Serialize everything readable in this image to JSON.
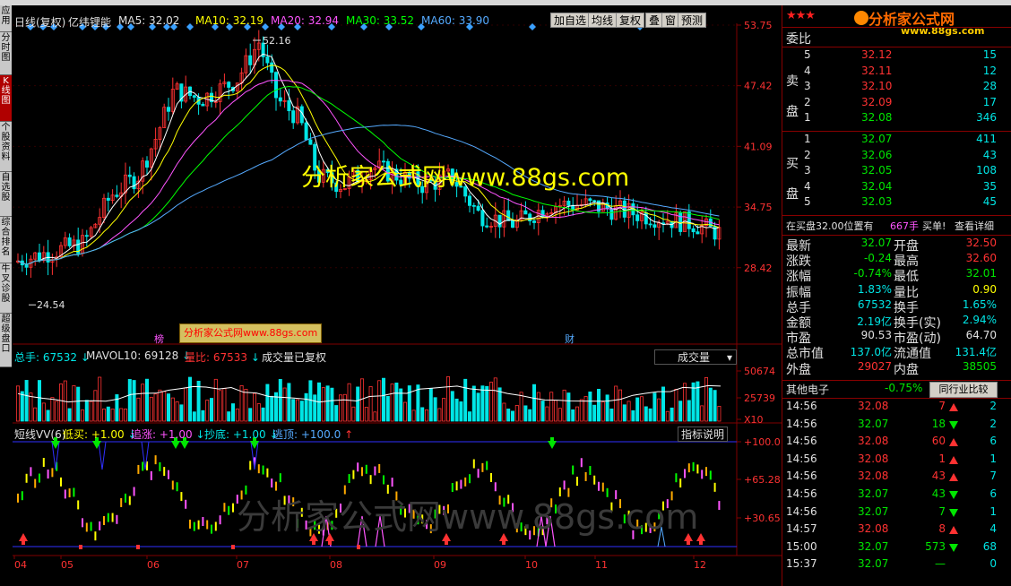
{
  "left_tabs": [
    "应用",
    "分时图",
    "K线图",
    "个股资料",
    "自选股",
    "综合排名",
    "牛叉诊股",
    "超级盘口"
  ],
  "main_header": {
    "period": "日线(复权)",
    "stock_name": "亿纬锂能",
    "ma5": "MA5: 32.02",
    "ma10": "MA10: 32.19",
    "ma20": "MA20: 32.94",
    "ma30": "MA30: 33.52",
    "ma60": "MA60: 33.90"
  },
  "toolbar": {
    "add_watch": "加自选",
    "avg_line": "均线",
    "restore_rights": "复权",
    "overlay": "叠",
    "window": "窗",
    "forecast": "预测"
  },
  "price_axis": [
    "53.75",
    "47.42",
    "41.09",
    "34.75",
    "28.42"
  ],
  "annotations": {
    "high": "52.16",
    "low": "24.54",
    "bang": "榜",
    "cai": "财"
  },
  "watermark_center": "分析家公式网www.88gs.com",
  "watermark_box": "分析家公式网www.88gs.com",
  "watermark_bottom": "分析家公式网www.88gs.com",
  "volume_header": {
    "total": "总手: 67532",
    "mavol": "MAVOL10: 69128",
    "ratio": "量比: 67533",
    "note": "成交量已复权",
    "selector": "成交量"
  },
  "volume_axis": [
    "50674",
    "25739",
    "X10"
  ],
  "indicator_header": {
    "name": "短线VV(6)",
    "low_buy": "低买: +1.00",
    "chase": "追涨: +1.00",
    "bottom": "抄底: +1.00",
    "escape": "逃顶: +100.0",
    "help": "指标说明"
  },
  "indicator_axis": [
    "+100.0",
    "+65.28",
    "+30.65"
  ],
  "x_axis": [
    "04",
    "05",
    "06",
    "07",
    "08",
    "09",
    "10",
    "11",
    "12"
  ],
  "logo": {
    "stars": "★★★",
    "text": "分析家公式网",
    "url": "www.88gs.com"
  },
  "order_book": {
    "ratio_label": "委比",
    "sell_label": [
      "卖",
      "盘"
    ],
    "buy_label": [
      "买",
      "盘"
    ],
    "sell": [
      {
        "level": "5",
        "price": "32.12",
        "vol": "15"
      },
      {
        "level": "4",
        "price": "32.11",
        "vol": "12"
      },
      {
        "level": "3",
        "price": "32.10",
        "vol": "28"
      },
      {
        "level": "2",
        "price": "32.09",
        "vol": "17"
      },
      {
        "level": "1",
        "price": "32.08",
        "vol": "346"
      }
    ],
    "buy": [
      {
        "level": "1",
        "price": "32.07",
        "vol": "411"
      },
      {
        "level": "2",
        "price": "32.06",
        "vol": "43"
      },
      {
        "level": "3",
        "price": "32.05",
        "vol": "108"
      },
      {
        "level": "4",
        "price": "32.04",
        "vol": "35"
      },
      {
        "level": "5",
        "price": "32.03",
        "vol": "45"
      }
    ],
    "status": {
      "text": "在买盘32.00位置有",
      "amount": "667手",
      "action": "买单!",
      "detail": "查看详细"
    }
  },
  "quote": [
    {
      "l1": "最新",
      "v1": "32.07",
      "c1": "green",
      "l2": "开盘",
      "v2": "32.50",
      "c2": "red"
    },
    {
      "l1": "涨跌",
      "v1": "-0.24",
      "c1": "green",
      "l2": "最高",
      "v2": "32.60",
      "c2": "red"
    },
    {
      "l1": "涨幅",
      "v1": "-0.74%",
      "c1": "green",
      "l2": "最低",
      "v2": "32.01",
      "c2": "green"
    },
    {
      "l1": "振幅",
      "v1": "1.83%",
      "c1": "cyan",
      "l2": "量比",
      "v2": "0.90",
      "c2": "yellow"
    },
    {
      "l1": "总手",
      "v1": "67532",
      "c1": "cyan",
      "l2": "换手",
      "v2": "1.65%",
      "c2": "cyan"
    },
    {
      "l1": "金额",
      "v1": "2.19亿",
      "c1": "cyan",
      "l2": "换手(实)",
      "v2": "2.94%",
      "c2": "cyan"
    },
    {
      "l1": "市盈",
      "v1": "90.53",
      "c1": "white",
      "l2": "市盈(动)",
      "v2": "64.70",
      "c2": "white"
    },
    {
      "l1": "总市值",
      "v1": "137.0亿",
      "c1": "cyan",
      "l2": "流通值",
      "v2": "131.4亿",
      "c2": "cyan"
    },
    {
      "l1": "外盘",
      "v1": "29027",
      "c1": "red",
      "l2": "内盘",
      "v2": "38505",
      "c2": "green"
    }
  ],
  "sector": {
    "name": "其他电子",
    "change": "-0.75%",
    "button": "同行业比较"
  },
  "trades": [
    {
      "time": "14:56",
      "price": "32.08",
      "pc": "red",
      "vol": "7",
      "vc": "red",
      "dir": "up",
      "cnt": "2"
    },
    {
      "time": "14:56",
      "price": "32.07",
      "pc": "green",
      "vol": "18",
      "vc": "green",
      "dir": "down",
      "cnt": "2"
    },
    {
      "time": "14:56",
      "price": "32.08",
      "pc": "red",
      "vol": "60",
      "vc": "red",
      "dir": "up",
      "cnt": "6"
    },
    {
      "time": "14:56",
      "price": "32.08",
      "pc": "red",
      "vol": "1",
      "vc": "red",
      "dir": "up",
      "cnt": "1"
    },
    {
      "time": "14:56",
      "price": "32.08",
      "pc": "red",
      "vol": "43",
      "vc": "red",
      "dir": "up",
      "cnt": "7"
    },
    {
      "time": "14:56",
      "price": "32.07",
      "pc": "green",
      "vol": "43",
      "vc": "green",
      "dir": "down",
      "cnt": "6"
    },
    {
      "time": "14:56",
      "price": "32.07",
      "pc": "green",
      "vol": "7",
      "vc": "green",
      "dir": "down",
      "cnt": "1"
    },
    {
      "time": "14:57",
      "price": "32.08",
      "pc": "red",
      "vol": "8",
      "vc": "red",
      "dir": "up",
      "cnt": "4"
    },
    {
      "time": "15:00",
      "price": "32.07",
      "pc": "green",
      "vol": "573",
      "vc": "green",
      "dir": "down",
      "cnt": "68"
    },
    {
      "time": "15:37",
      "price": "32.07",
      "pc": "green",
      "vol": "—",
      "vc": "green",
      "dir": "none",
      "cnt": "0"
    }
  ],
  "colors": {
    "up": "#ff3232",
    "down": "#00e6e6",
    "ma5": "#ffffff",
    "ma10": "#ffff00",
    "ma20": "#ff55ff",
    "ma30": "#00ff00",
    "ma60": "#55aaff",
    "grid": "#800000"
  }
}
